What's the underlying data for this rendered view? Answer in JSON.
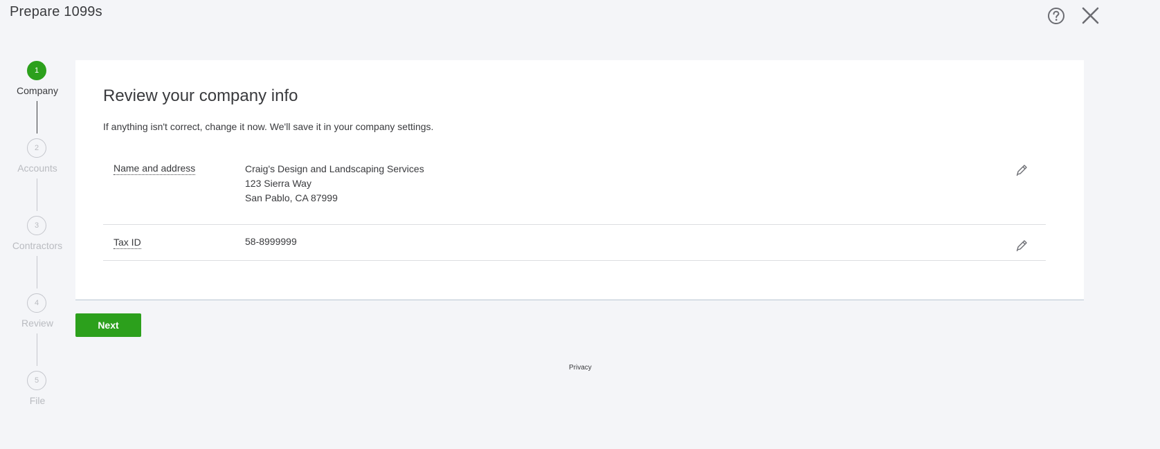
{
  "header": {
    "title": "Prepare 1099s",
    "help_icon": "help-circle-icon",
    "close_icon": "close-icon"
  },
  "stepper": {
    "steps": [
      {
        "number": "1",
        "label": "Company",
        "state": "active"
      },
      {
        "number": "2",
        "label": "Accounts",
        "state": "upcoming"
      },
      {
        "number": "3",
        "label": "Contractors",
        "state": "upcoming"
      },
      {
        "number": "4",
        "label": "Review",
        "state": "upcoming"
      },
      {
        "number": "5",
        "label": "File",
        "state": "upcoming"
      }
    ]
  },
  "card": {
    "heading": "Review your company info",
    "subtext": "If anything isn't correct, change it now. We'll save it in your company settings.",
    "rows": [
      {
        "label": "Name and address",
        "lines": [
          "Craig's Design and Landscaping Services",
          "123 Sierra Way",
          "San Pablo, CA 87999"
        ],
        "edit_icon": "pencil-icon"
      },
      {
        "label": "Tax ID",
        "lines": [
          "58-8999999"
        ],
        "edit_icon": "pencil-icon"
      }
    ]
  },
  "actions": {
    "next_label": "Next"
  },
  "footer": {
    "privacy_label": "Privacy"
  },
  "colors": {
    "accent": "#2ca01c",
    "background": "#f4f5f8",
    "text": "#393a3d",
    "muted": "#b9bbc0"
  }
}
